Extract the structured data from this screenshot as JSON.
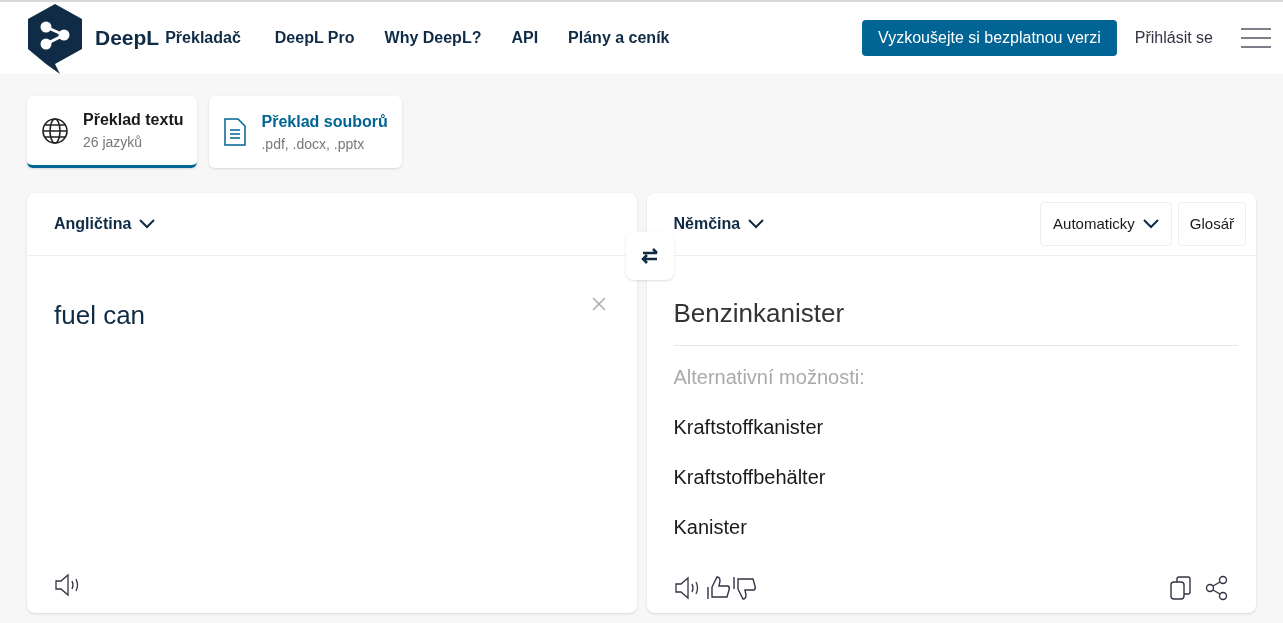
{
  "header": {
    "brand": "DeepL",
    "product": "Překladač",
    "nav": [
      "DeepL Pro",
      "Why DeepL?",
      "API",
      "Plány a ceník"
    ],
    "cta": "Vyzkoušejte si bezplatnou verzi",
    "login": "Přihlásit se"
  },
  "mode_tabs": [
    {
      "kind": "text",
      "title": "Překlad textu",
      "subtitle": "26 jazyků",
      "selected": true
    },
    {
      "kind": "files",
      "title": "Překlad souborů",
      "subtitle": ".pdf, .docx, .pptx",
      "selected": false
    }
  ],
  "source": {
    "language": "Angličtina",
    "text": "fuel can"
  },
  "target": {
    "language": "Němčina",
    "formality": "Automaticky",
    "glossary": "Glosář",
    "translation": "Benzinkanister",
    "alternatives_label": "Alternativní možnosti:",
    "alternatives": [
      "Kraftstoffkanister",
      "Kraftstoffbehälter",
      "Kanister"
    ]
  }
}
